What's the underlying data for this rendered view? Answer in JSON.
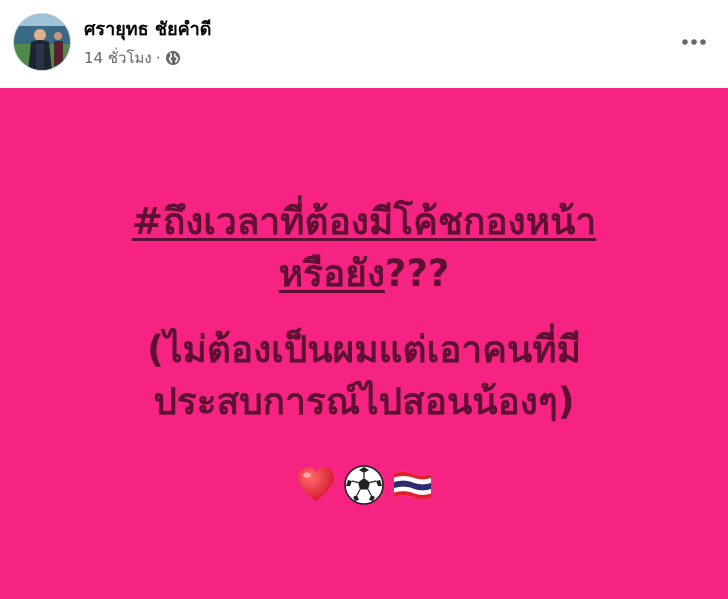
{
  "post": {
    "author": "ศรายุทธ ชัยคำดี",
    "time": "14 ชั่วโมง",
    "separator": "·",
    "privacy_icon": "globe-icon",
    "more_icon": "more-horizontal-icon",
    "background_color": "#f72383",
    "text_color": "#5e1033",
    "hashtag_part1": "#ถึงเวลาที่ต้องมีโค้ชกองหน้า",
    "hashtag_part2": "หรือยัง",
    "hashtag_suffix": "???",
    "body_line1": "(ไม่ต้องเป็นผมแต่เอาคนที่มี",
    "body_line2": "ประสบการณ์ไปสอนน้องๆ)",
    "emojis": [
      "heart-icon",
      "soccer-ball-icon",
      "thai-flag-icon"
    ]
  }
}
